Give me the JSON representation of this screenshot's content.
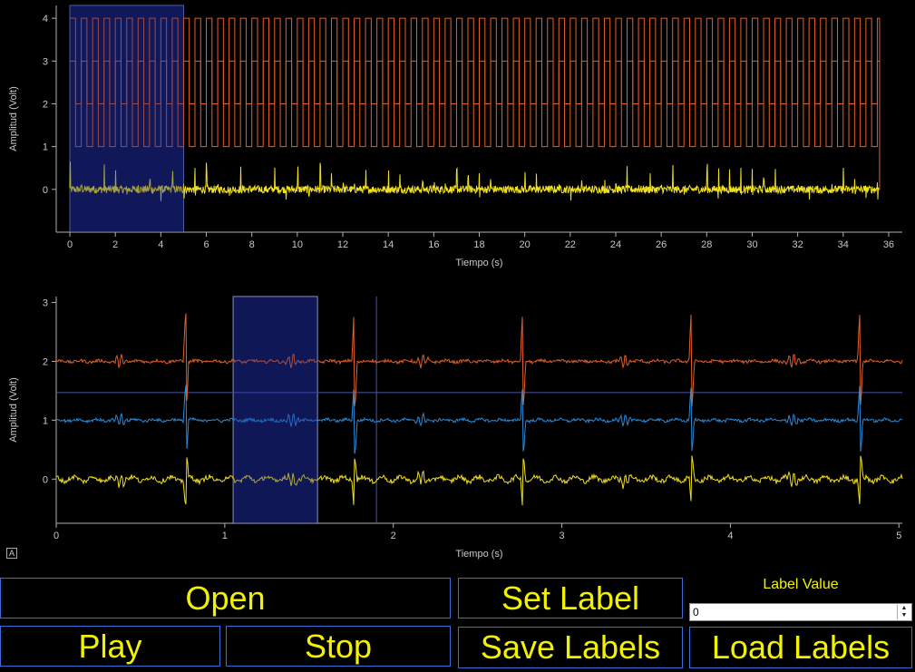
{
  "top_plot": {
    "ylabel": "Amplitud (Volt)",
    "xlabel": "Tiempo (s)",
    "x_ticks": [
      "0",
      "2",
      "4",
      "6",
      "8",
      "10",
      "12",
      "14",
      "16",
      "18",
      "20",
      "22",
      "24",
      "26",
      "28",
      "30",
      "32",
      "34",
      "36"
    ],
    "y_ticks": [
      "0",
      "1",
      "2",
      "3",
      "4"
    ],
    "selection_range_s": [
      0,
      5
    ]
  },
  "bottom_plot": {
    "ylabel": "Amplitud (Volt)",
    "xlabel": "Tiempo (s)",
    "x_ticks": [
      "0",
      "1",
      "2",
      "3",
      "4",
      "5"
    ],
    "y_ticks": [
      "0",
      "1",
      "2",
      "3"
    ],
    "selection_range_s": [
      1.05,
      1.55
    ],
    "cursor_x_s": 1.9,
    "cursor_y_v": 1.47
  },
  "chart_data": [
    {
      "type": "line",
      "title": "",
      "xlabel": "Tiempo (s)",
      "ylabel": "Amplitud (Volt)",
      "xlim": [
        -0.6,
        36.6
      ],
      "ylim": [
        -1,
        4.3
      ],
      "series": [
        {
          "values_note": "square wave 1-4 V, period 0.5 s",
          "color": "#e0602a"
        },
        {
          "values_note": "square wave 2-3 V, period 0.5 s",
          "color": "#e0602a"
        },
        {
          "values_note": "ECG-like signal around 0 V",
          "color": "#f0e020"
        }
      ]
    },
    {
      "type": "line",
      "title": "",
      "xlabel": "Tiempo (s)",
      "ylabel": "Amplitud (Volt)",
      "xlim": [
        0,
        5.02
      ],
      "ylim": [
        -0.75,
        3.1
      ],
      "series": [
        {
          "offset": 2,
          "color": "#e0602a"
        },
        {
          "offset": 1,
          "color": "#2a8ad8"
        },
        {
          "offset": 0,
          "color": "#f0e020"
        }
      ],
      "beat_times_s": [
        0.38,
        0.77,
        1.4,
        1.77,
        2.17,
        2.77,
        3.37,
        3.77,
        4.37,
        4.77
      ]
    }
  ],
  "buttons": {
    "open": "Open",
    "set_label": "Set Label",
    "play": "Play",
    "stop": "Stop",
    "save_labels": "Save Labels",
    "load_labels": "Load Labels"
  },
  "label_value": {
    "title": "Label Value",
    "value": "0"
  },
  "colors": {
    "accent_text": "#f2f200",
    "button_border": "#3b6fd6",
    "selection_fill": "#0a1040"
  }
}
